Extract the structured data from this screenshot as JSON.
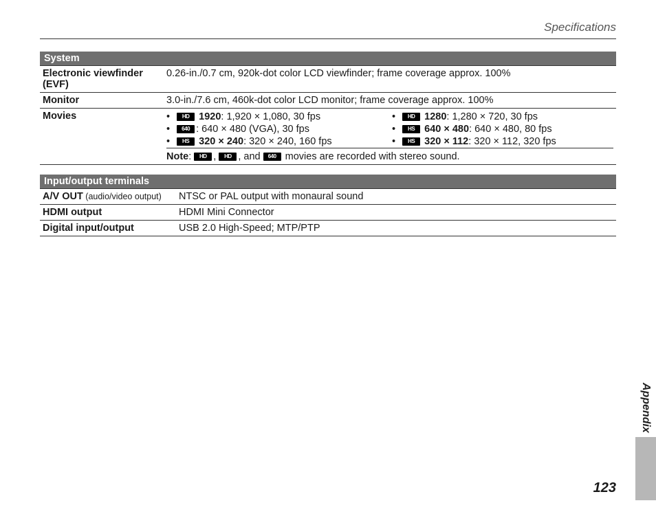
{
  "page": {
    "running_head": "Specifications",
    "side_label": "Appendix",
    "page_number": "123"
  },
  "icons": {
    "fullhd": "HD",
    "hd": "HD",
    "vga": "640",
    "hs": "HS"
  },
  "system": {
    "header": "System",
    "rows": {
      "evf": {
        "label": "Electronic viewfinder (EVF)",
        "value": "0.26-in./0.7 cm, 920k-dot color LCD viewfinder; frame coverage approx. 100%"
      },
      "monitor": {
        "label": "Monitor",
        "value": "3.0-in./7.6 cm, 460k-dot color LCD monitor; frame coverage approx. 100%"
      },
      "movies": {
        "label": "Movies",
        "colA": {
          "b1_bold": "1920",
          "b1_rest": ": 1,920 × 1,080, 30 fps",
          "b2_rest": ": 640 × 480 (VGA), 30 fps",
          "b3_bold": "320 × 240",
          "b3_rest": ": 320 × 240, 160 fps"
        },
        "colB": {
          "b1_bold": "1280",
          "b1_rest": ": 1,280 × 720, 30 fps",
          "b2_bold": "640 × 480",
          "b2_rest": ": 640 × 480, 80 fps",
          "b3_bold": "320 × 112",
          "b3_rest": ": 320 × 112, 320 fps"
        },
        "note_label": "Note",
        "note_mid": ", ",
        "note_mid2": ", and ",
        "note_rest": " movies are recorded with stereo sound."
      }
    }
  },
  "io": {
    "header": "Input/output terminals",
    "rows": {
      "avout": {
        "label_bold": "A/V OUT",
        "label_sub": " (audio/video output)",
        "value": "NTSC or PAL output with monaural sound"
      },
      "hdmi": {
        "label": "HDMI output",
        "value": "HDMI Mini Connector"
      },
      "digital": {
        "label": "Digital input/output",
        "value": "USB 2.0 High-Speed; MTP/PTP"
      }
    }
  }
}
